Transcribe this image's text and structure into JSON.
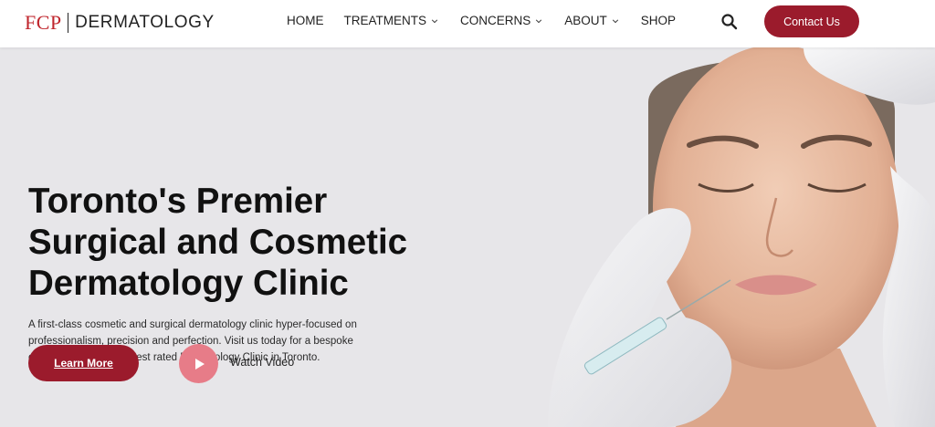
{
  "header": {
    "logo_mark": "FCP",
    "logo_text": "DERMATOLOGY",
    "nav": [
      {
        "label": "HOME",
        "has_dropdown": false
      },
      {
        "label": "TREATMENTS",
        "has_dropdown": true
      },
      {
        "label": "CONCERNS",
        "has_dropdown": true
      },
      {
        "label": "ABOUT",
        "has_dropdown": true
      },
      {
        "label": "SHOP",
        "has_dropdown": false
      }
    ],
    "search_icon": "search-icon",
    "contact_label": "Contact Us"
  },
  "hero": {
    "title": "Toronto's Premier Surgical and Cosmetic Dermatology Clinic",
    "subtitle": "A first-class cosmetic and surgical dermatology clinic hyper-focused on professionalism, precision and perfection. Visit us today for a bespoke consultation at the highest rated Dermatology Clinic in Toronto.",
    "learn_more_label": "Learn More",
    "watch_video_label": "Watch Video",
    "play_icon": "play-icon"
  },
  "colors": {
    "brand": "#9b1b2c",
    "logo_red": "#c0262d",
    "play_pink": "#e77c88",
    "hero_bg": "#e7e6e9"
  }
}
